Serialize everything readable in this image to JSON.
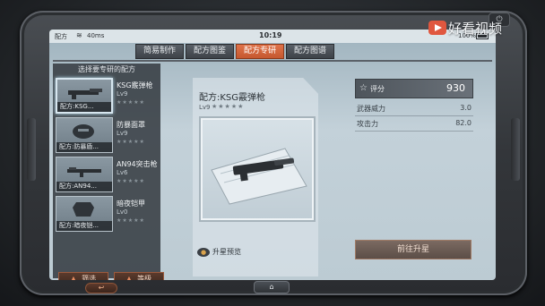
{
  "status": {
    "carrier": "配方",
    "ping": "40ms",
    "time": "10:19",
    "battery": "100%"
  },
  "tabs": [
    {
      "label": "简易制作",
      "active": false
    },
    {
      "label": "配方图鉴",
      "active": false
    },
    {
      "label": "配方专研",
      "active": true
    },
    {
      "label": "配方图谱",
      "active": false
    }
  ],
  "left": {
    "title": "选择要专研的配方",
    "items": [
      {
        "caption": "配方:KSG...",
        "name": "KSG霰弹枪",
        "level": "Lv9",
        "selected": true
      },
      {
        "caption": "配方:防暴盾...",
        "name": "防暴面罩",
        "level": "Lv9",
        "selected": false
      },
      {
        "caption": "配方:AN94...",
        "name": "AN94突击枪",
        "level": "Lv6",
        "selected": false
      },
      {
        "caption": "配方:暗夜铠...",
        "name": "暗夜铠甲",
        "level": "Lv0",
        "selected": false
      }
    ],
    "stars": "★★★★★",
    "filter_label": "筛选",
    "level_label": "等级"
  },
  "center": {
    "recipe_title": "配方:KSG霰弹枪",
    "level": "Lv9",
    "stars": "★★★★★",
    "preview_label": "升星预览"
  },
  "right": {
    "score_label": "评分",
    "score_value": "930",
    "stats": [
      {
        "key": "武器威力",
        "value": "3.0"
      },
      {
        "key": "攻击力",
        "value": "82.0"
      }
    ],
    "upgrade_label": "前往升星"
  },
  "watermark": {
    "text": "好看视频"
  },
  "colors": {
    "accent": "#d4653c",
    "panel": "#32383e",
    "screen": "#c3d1d9"
  }
}
